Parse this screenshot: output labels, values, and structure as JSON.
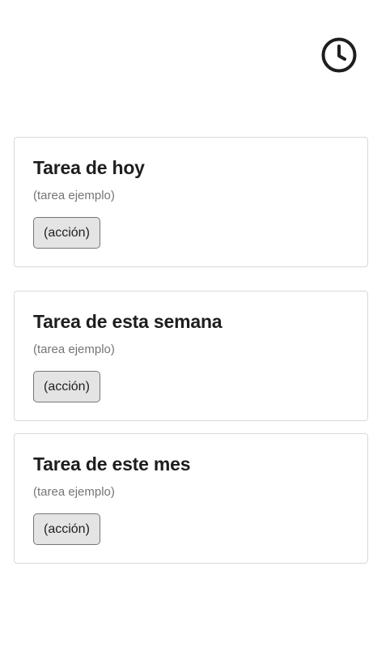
{
  "header": {
    "history_icon": "clock-icon"
  },
  "tasks": [
    {
      "title": "Tarea de hoy",
      "subtitle": "(tarea ejemplo)",
      "action_label": "(acción)"
    },
    {
      "title": "Tarea de esta semana",
      "subtitle": "(tarea ejemplo)",
      "action_label": "(acción)"
    },
    {
      "title": "Tarea de este mes",
      "subtitle": "(tarea ejemplo)",
      "action_label": "(acción)"
    }
  ],
  "colors": {
    "text": "#1e1e1e",
    "muted_text": "#757575",
    "border": "#d9d9d9",
    "button_bg": "#e4e4e4"
  }
}
